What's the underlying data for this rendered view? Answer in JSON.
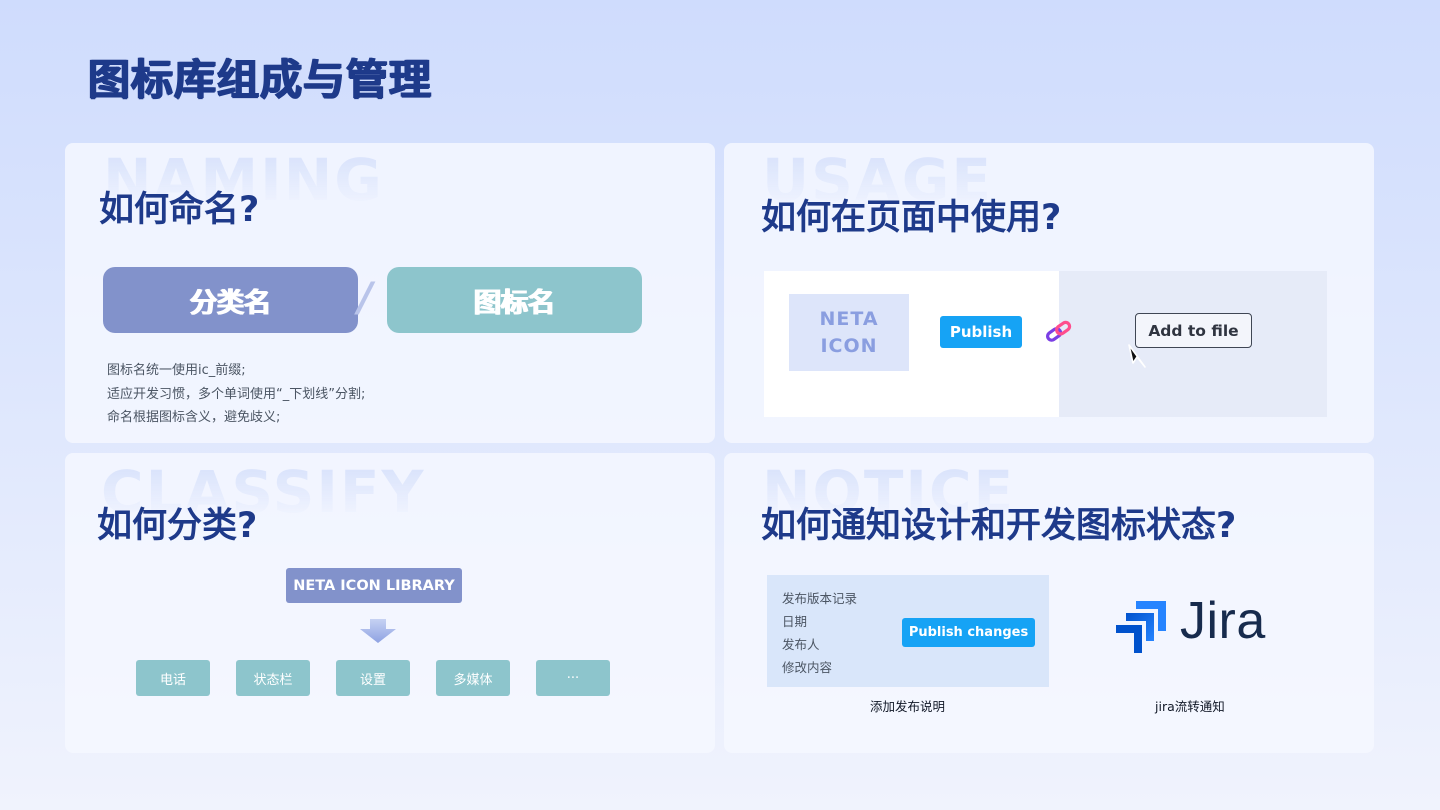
{
  "title": "图标库组成与管理",
  "naming": {
    "bg_word": "NAMING",
    "heading": "如何命名?",
    "pill_category": "分类名",
    "slash": "/",
    "pill_name": "图标名",
    "notes": [
      "图标名统一使用ic_前缀;",
      "适应开发习惯，多个单词使用“_下划线”分割;",
      "命名根据图标含义，避免歧义;"
    ]
  },
  "usage": {
    "bg_word": "USAGE",
    "heading": "如何在页面中使用?",
    "neta_line1": "NETA",
    "neta_line2": "ICON",
    "publish_label": "Publish",
    "add_to_file_label": "Add to file"
  },
  "classify": {
    "bg_word": "CLASSIFY",
    "heading": "如何分类?",
    "library_label": "NETA ICON LIBRARY",
    "categories": [
      "电话",
      "状态栏",
      "设置",
      "多媒体",
      "···"
    ]
  },
  "notice": {
    "bg_word": "NOTICE",
    "heading": "如何通知设计和开发图标状态?",
    "release_lines": [
      "发布版本记录",
      "日期",
      "发布人",
      "修改内容"
    ],
    "publish_changes_label": "Publish changes",
    "caption_release": "添加发布说明",
    "jira_word": "Jira",
    "caption_jira": "jira流转通知"
  },
  "colors": {
    "title": "#1e3a8a",
    "pill_purple": "#8292cb",
    "pill_teal": "#8dc5cc",
    "publish_blue": "#16a3f5",
    "jira_blue": "#2684ff"
  }
}
